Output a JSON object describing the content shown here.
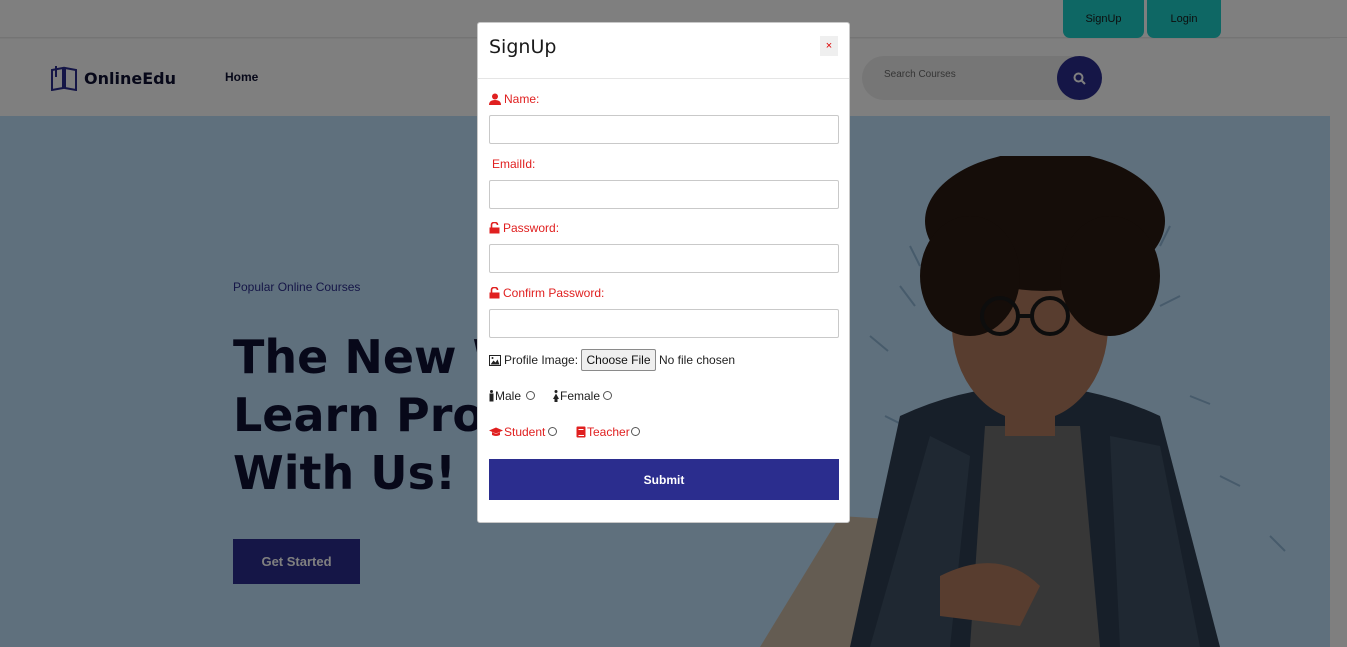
{
  "topbar": {
    "signup_label": "SignUp",
    "login_label": "Login"
  },
  "nav": {
    "brand": "OnlineEdu",
    "home": "Home",
    "search_placeholder": "Search Courses"
  },
  "hero": {
    "subtitle": "Popular Online Courses",
    "title_lines": [
      "The New W",
      "Learn Prop",
      "With Us!"
    ],
    "cta": "Get Started"
  },
  "modal": {
    "title": "SignUp",
    "close": "×",
    "name_label": "Name:",
    "email_label": "EmailId:",
    "password_label": "Password:",
    "confirm_label": "Confirm Password:",
    "profile_label": "Profile Image:",
    "file_button": "Choose File",
    "file_status": "No file chosen",
    "male": "Male",
    "female": "Female",
    "student": "Student",
    "teacher": "Teacher",
    "submit": "Submit"
  },
  "colors": {
    "accent": "#2b2d8e",
    "teal": "#1ccfc9",
    "label_red": "#e02020",
    "hero_bg": "#bfe0fb"
  }
}
